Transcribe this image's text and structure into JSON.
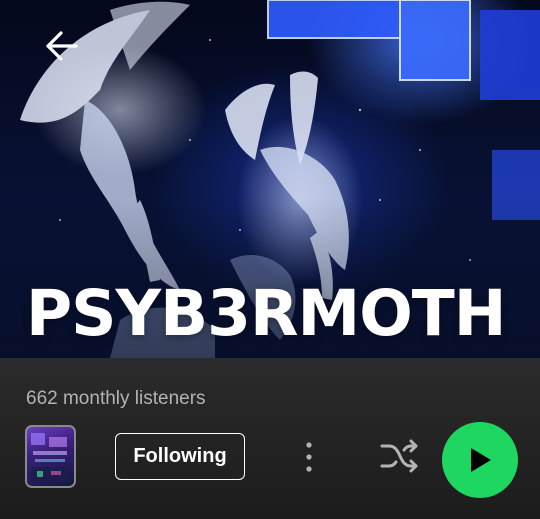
{
  "header": {
    "back_icon": "arrow-left-icon"
  },
  "artist": {
    "name": "PSYB3RMOTH",
    "monthly_listeners": "662 monthly listeners"
  },
  "actions": {
    "following_label": "Following",
    "more_icon": "more-vertical-icon",
    "shuffle_icon": "shuffle-icon",
    "play_icon": "play-icon"
  },
  "colors": {
    "accent_green": "#1ed760",
    "bar_background": "#242424",
    "muted_text": "#b3b3b3"
  }
}
